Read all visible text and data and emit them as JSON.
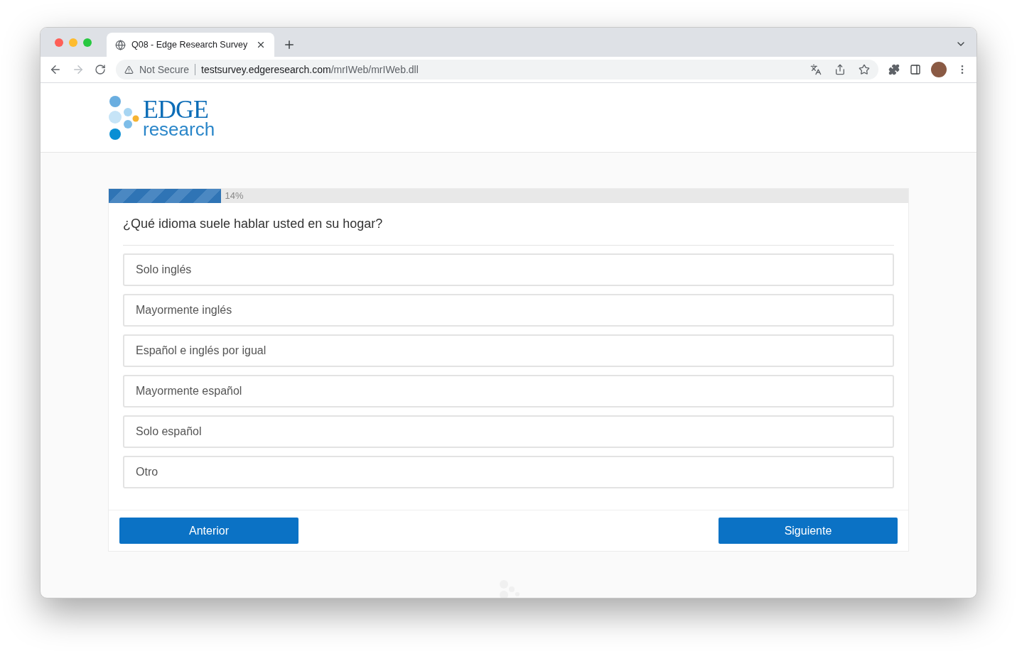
{
  "browser": {
    "tab_title": "Q08 - Edge Research Survey",
    "security_label": "Not Secure",
    "url_host": "testsurvey.edgeresearch.com",
    "url_path": "/mrIWeb/mrIWeb.dll"
  },
  "logo": {
    "wordmark": "EDGE",
    "subtitle": "research"
  },
  "progress": {
    "level": 0.14,
    "label": "14%"
  },
  "question": "¿Qué idioma suele hablar usted en su hogar?",
  "options": [
    {
      "label": "Solo inglés",
      "selected": false
    },
    {
      "label": "Mayormente inglés",
      "selected": false
    },
    {
      "label": "Español e inglés por igual",
      "selected": false
    },
    {
      "label": "Mayormente español",
      "selected": false
    },
    {
      "label": "Solo español",
      "selected": false
    },
    {
      "label": "Otro",
      "selected": false
    }
  ],
  "buttons": {
    "previous": "Anterior",
    "next": "Siguiente"
  }
}
